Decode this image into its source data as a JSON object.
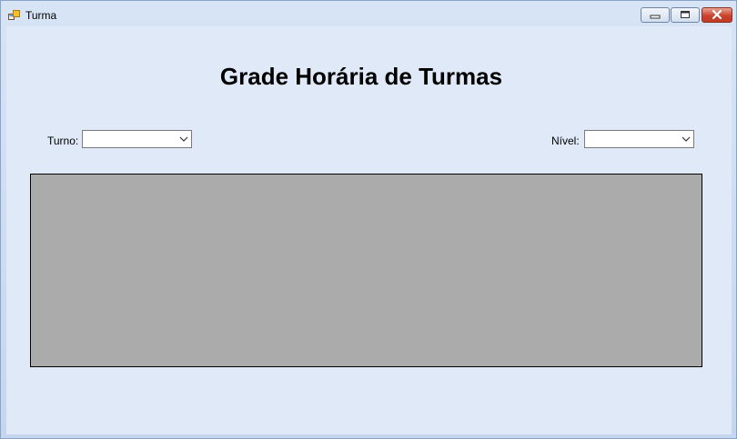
{
  "window": {
    "title": "Turma",
    "icon": "form-window-icon",
    "controls": {
      "minimize_icon": "minimize-icon",
      "maximize_icon": "maximize-icon",
      "close_icon": "close-icon"
    }
  },
  "form": {
    "heading": "Grade Horária de Turmas",
    "turno": {
      "label": "Turno:",
      "value": ""
    },
    "nivel": {
      "label": "Nível:",
      "value": ""
    },
    "grid": {
      "rows": []
    }
  },
  "colors": {
    "client_background": "#dfe9f8",
    "grid_background": "#ababab",
    "close_button": "#c9432e"
  }
}
